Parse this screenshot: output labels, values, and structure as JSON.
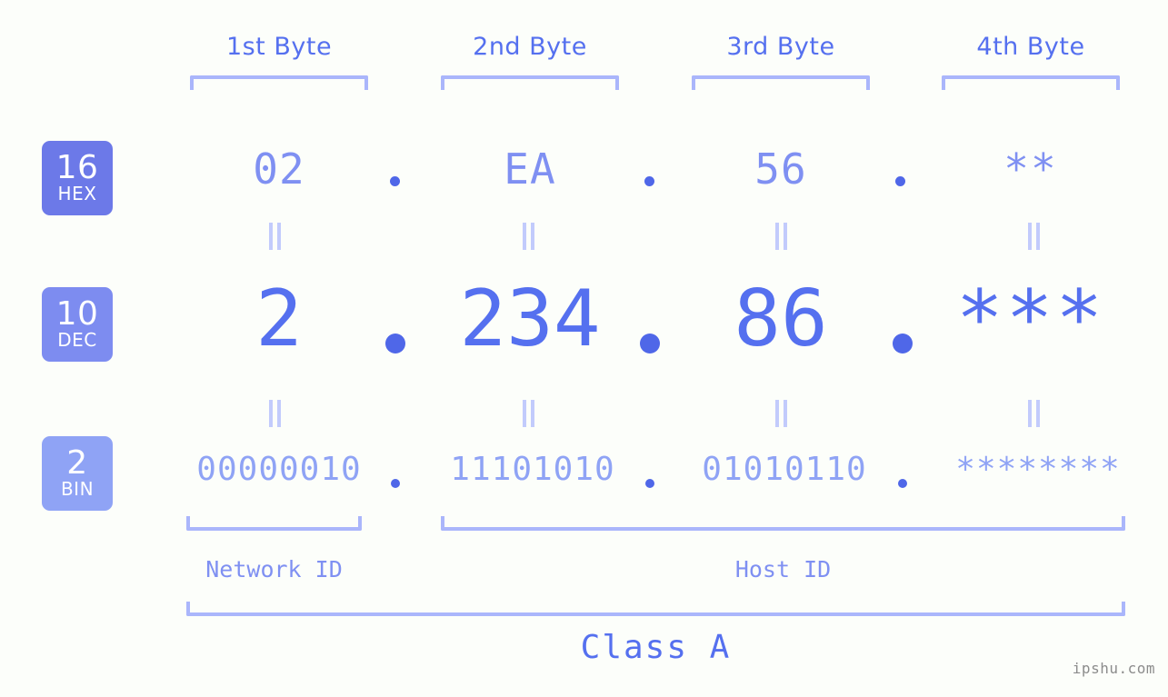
{
  "watermark": "ipshu.com",
  "byte_headers": [
    {
      "label": "1st Byte"
    },
    {
      "label": "2nd Byte"
    },
    {
      "label": "3rd Byte"
    },
    {
      "label": "4th Byte"
    }
  ],
  "bases": [
    {
      "number": "16",
      "name": "HEX",
      "color": "#6c79e8"
    },
    {
      "number": "10",
      "name": "DEC",
      "color": "#7d8cf0"
    },
    {
      "number": "2",
      "name": "BIN",
      "color": "#8fa3f5"
    }
  ],
  "rows": {
    "hex": {
      "base_number": "16",
      "base_name": "HEX",
      "values": [
        "02",
        "EA",
        "56",
        "**"
      ],
      "separator": "."
    },
    "dec": {
      "base_number": "10",
      "base_name": "DEC",
      "values": [
        "2",
        "234",
        "86",
        "***"
      ],
      "separator": "."
    },
    "bin": {
      "base_number": "2",
      "base_name": "BIN",
      "values": [
        "00000010",
        "11101010",
        "01010110",
        "********"
      ],
      "separator": "."
    }
  },
  "segments": {
    "network_id": "Network ID",
    "host_id": "Host ID",
    "class": "Class A"
  },
  "colors": {
    "background": "#fcfefa",
    "accent_strong": "#5570ef",
    "accent_mid": "#7f90f2",
    "accent_light": "#8fa3f5",
    "bracket": "#aab6fb",
    "dot": "#4f67e8",
    "equals": "#c2cbfc",
    "watermark": "#8c8c8c"
  }
}
